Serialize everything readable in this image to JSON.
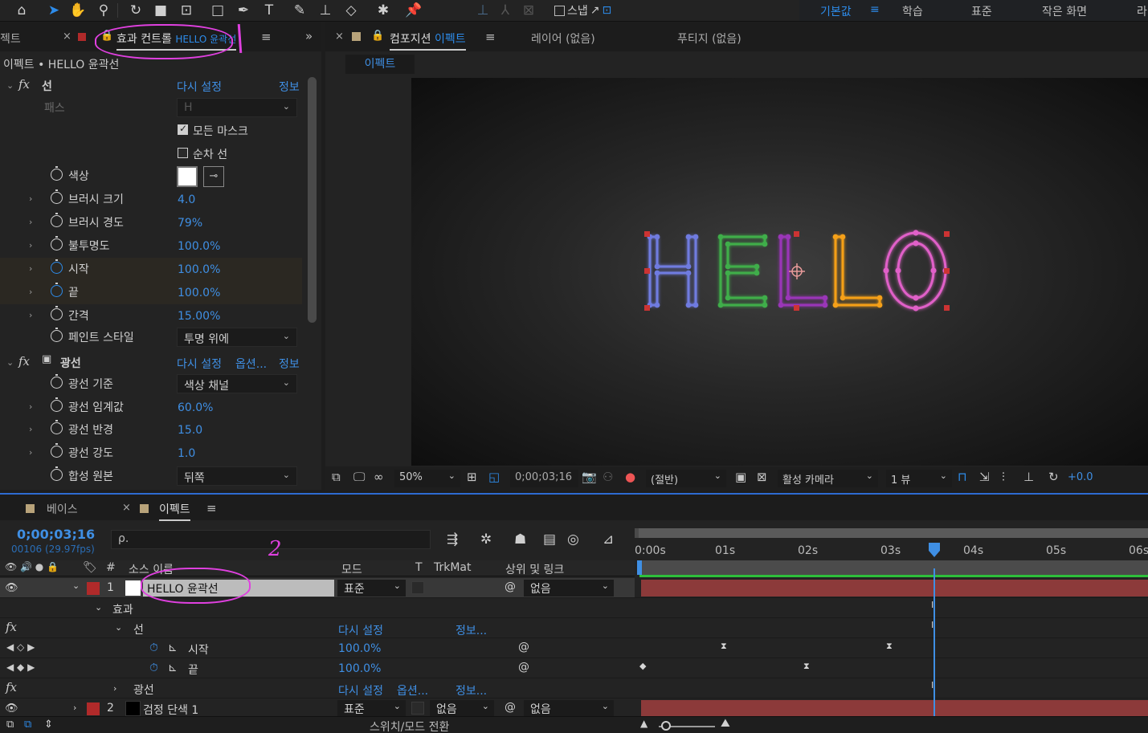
{
  "toolbar": {
    "snap_label": "스냅",
    "workspaces": [
      "기본값",
      "학습",
      "표준",
      "작은 화면",
      "라"
    ],
    "active_workspace": "기본값"
  },
  "effect_controls": {
    "left_cut_tab": "젝트",
    "tab_prefix": "효과 컨트롤",
    "tab_layer": "HELLO 윤곽선",
    "subtitle": "이펙트 • HELLO 윤곽선",
    "stroke": {
      "name": "선",
      "reset": "다시 설정",
      "info": "정보",
      "path_label": "패스",
      "path_value": "H",
      "all_masks": "모든 마스크",
      "sequential": "순차 선",
      "props": [
        {
          "label": "색상"
        },
        {
          "label": "브러시 크기",
          "value": "4.0"
        },
        {
          "label": "브러시 경도",
          "value": "79%"
        },
        {
          "label": "불투명도",
          "value": "100.0%"
        },
        {
          "label": "시작",
          "value": "100.0%"
        },
        {
          "label": "끝",
          "value": "100.0%"
        },
        {
          "label": "간격",
          "value": "15.00%"
        },
        {
          "label": "페인트 스타일",
          "value": "투명 위에"
        }
      ]
    },
    "glow": {
      "name": "광선",
      "reset": "다시 설정",
      "options": "옵션...",
      "info": "정보",
      "props": [
        {
          "label": "광선 기준",
          "value": "색상 채널"
        },
        {
          "label": "광선 임계값",
          "value": "60.0%"
        },
        {
          "label": "광선 반경",
          "value": "15.0"
        },
        {
          "label": "광선 강도",
          "value": "1.0"
        },
        {
          "label": "합성 원본",
          "value": "뒤쪽"
        }
      ]
    }
  },
  "composition": {
    "tab_label": "컴포지션",
    "tab_name": "이펙트",
    "layer_tab": "레이어 (없음)",
    "footage_tab": "푸티지 (없음)",
    "sub_tab": "이펙트",
    "footer": {
      "zoom": "50%",
      "timecode": "0;00;03;16",
      "resolution": "(절반)",
      "camera": "활성 카메라",
      "views": "1 뷰",
      "exposure": "+0.0"
    },
    "letters": [
      "H",
      "E",
      "L",
      "L",
      "O"
    ],
    "letter_colors": [
      "#6f7be0",
      "#3fae4a",
      "#9a36b8",
      "#f5a019",
      "#e060c8"
    ]
  },
  "timeline": {
    "tab_base": "베이스",
    "tab_effect": "이펙트",
    "timecode": "0;00;03;16",
    "fps": "00106 (29.97fps)",
    "search_placeholder": "ρ.",
    "col_source": "소스 이름",
    "col_mode": "모드",
    "col_t": "T",
    "col_trkmat": "TrkMat",
    "col_parent": "상위 및 링크",
    "layer1": {
      "num": "1",
      "name": "HELLO 윤곽선",
      "mode": "표준",
      "parent": "없음"
    },
    "effects_label": "효과",
    "stroke_label": "선",
    "stroke_reset": "다시 설정",
    "stroke_info": "정보...",
    "start_label": "시작",
    "start_value": "100.0%",
    "end_label": "끝",
    "end_value": "100.0%",
    "glow_label": "광선",
    "glow_reset": "다시 설정",
    "glow_options": "옵션...",
    "glow_info": "정보...",
    "layer2": {
      "num": "2",
      "name": "검정 단색 1",
      "mode": "표준",
      "trkmat": "없음",
      "parent": "없음"
    },
    "switch_mode": "스위치/모드 전환",
    "ruler": [
      "0:00s",
      "01s",
      "02s",
      "03s",
      "04s",
      "05s",
      "06s"
    ]
  },
  "annotations": {
    "mark1": "1",
    "mark2": "2"
  }
}
